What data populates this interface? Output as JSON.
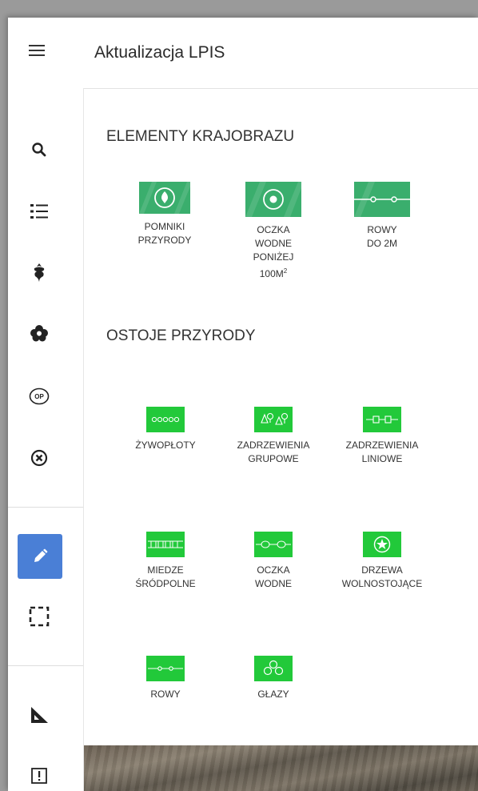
{
  "header": {
    "title": "Aktualizacja LPIS",
    "menu_icon": "hamburger-menu-icon"
  },
  "sidebar": {
    "icons": [
      "search-icon",
      "list-icon",
      "plant-icon",
      "flower-icon",
      "op-icon",
      "close-circle-icon",
      "pencil-icon",
      "select-area-icon",
      "ruler-icon",
      "alert-icon"
    ],
    "op_text": "OP",
    "active_item": "pencil-icon",
    "accent": "#4a7fd6"
  },
  "sections": {
    "landscape": {
      "title": "ELEMENTY KRAJOBRAZU",
      "items": [
        {
          "label": "POMNIKI\nPRZYRODY",
          "icon": "monument-icon"
        },
        {
          "label_main": "OCZKA\nWODNE\nPONIŻEJ\n100M",
          "label_sup": "2",
          "icon": "pond-icon"
        },
        {
          "label": "ROWY\nDO 2M",
          "icon": "ditch-icon"
        }
      ],
      "color": "#3aae6d"
    },
    "refuges": {
      "title": "OSTOJE PRZYRODY",
      "items": [
        {
          "label": "ŻYWOPŁOTY",
          "icon": "hedge-icon"
        },
        {
          "label": "ZADRZEWIENIA\nGRUPOWE",
          "icon": "tree-group-icon"
        },
        {
          "label": "ZADRZEWIENIA\nLINIOWE",
          "icon": "tree-line-icon"
        },
        {
          "label": "MIEDZE\nŚRÓDPOLNE",
          "icon": "balk-icon"
        },
        {
          "label": "OCZKA\nWODNE",
          "icon": "small-pond-icon"
        },
        {
          "label": "DRZEWA\nWOLNOSTOJĄCE",
          "icon": "single-tree-icon"
        },
        {
          "label": "ROWY",
          "icon": "ditch-small-icon"
        },
        {
          "label": "GŁAZY",
          "icon": "boulders-icon"
        }
      ],
      "color": "#22c93a"
    }
  }
}
